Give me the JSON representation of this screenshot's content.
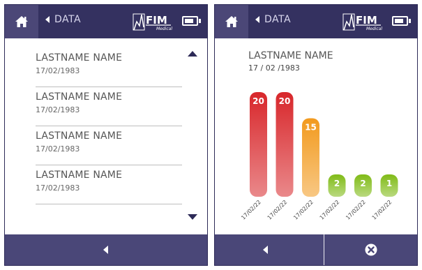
{
  "left_screen": {
    "header": {
      "data_label": "DATA",
      "home_icon": "home-icon",
      "logo_text": "FIM",
      "logo_sub": "Medical"
    },
    "patients": [
      {
        "name": "LASTNAME NAME",
        "dob": "17/02/1983"
      },
      {
        "name": "LASTNAME NAME",
        "dob": "17/02/1983"
      },
      {
        "name": "LASTNAME NAME",
        "dob": "17/02/1983"
      },
      {
        "name": "LASTNAME NAME",
        "dob": "17/02/1983"
      }
    ],
    "footer": {
      "back_icon": "chevron-left-icon"
    }
  },
  "right_screen": {
    "header": {
      "data_label": "DATA",
      "home_icon": "home-icon",
      "logo_text": "FIM",
      "logo_sub": "Medical"
    },
    "patient": {
      "name": "LASTNAME NAME",
      "dob": "17 / 02 /1983"
    },
    "footer": {
      "back_icon": "chevron-left-icon",
      "close_icon": "close-circle-icon"
    }
  },
  "chart_data": {
    "type": "bar",
    "categories": [
      "17/02/22",
      "17/02/22",
      "17/02/22",
      "17/02/22",
      "17/02/22",
      "17/02/22"
    ],
    "values": [
      20,
      20,
      15,
      2,
      2,
      1
    ],
    "colors": [
      "#d8272b",
      "#d8272b",
      "#f29a1e",
      "#80bb17",
      "#80bb17",
      "#80bb17"
    ],
    "title": "",
    "xlabel": "",
    "ylabel": ""
  },
  "colors": {
    "header_bg": "#343160",
    "home_bg": "#4b4777",
    "footer_bg": "#4a4778"
  }
}
